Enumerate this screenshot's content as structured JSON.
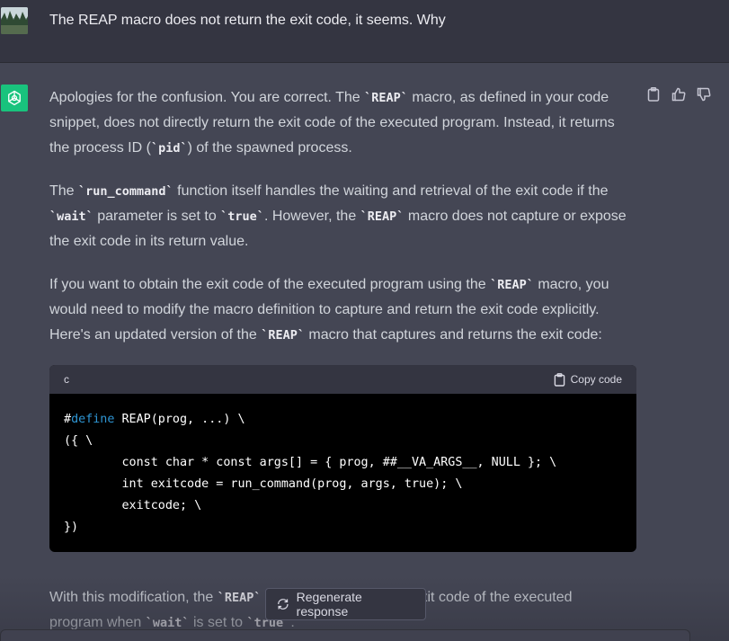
{
  "user_message": {
    "text": "The REAP macro does not return the exit code, it seems. Why"
  },
  "assistant_message": {
    "p1": {
      "a": "Apologies for the confusion. You are correct. The ",
      "code1": "`REAP`",
      "b": " macro, as defined in your code snippet, does not directly return the exit code of the executed program. Instead, it returns the process ID (",
      "code2": "`pid`",
      "c": ") of the spawned process."
    },
    "p2": {
      "a": "The ",
      "code1": "`run_command`",
      "b": " function itself handles the waiting and retrieval of the exit code if the ",
      "code2": "`wait`",
      "c": " parameter is set to ",
      "code3": "`true`",
      "d": ". However, the ",
      "code4": "`REAP`",
      "e": " macro does not capture or expose the exit code in its return value."
    },
    "p3": {
      "a": "If you want to obtain the exit code of the executed program using the ",
      "code1": "`REAP`",
      "b": " macro, you would need to modify the macro definition to capture and return the exit code explicitly. Here's an updated version of the ",
      "code2": "`REAP`",
      "c": " macro that captures and returns the exit code:"
    },
    "code_block": {
      "language": "c",
      "copy_label": "Copy code",
      "hash": "#",
      "keyword": "define",
      "line1_rest": " REAP(prog, ...) \\",
      "line2": "({ \\",
      "line3": "        const char * const args[] = { prog, ##__VA_ARGS__, NULL }; \\",
      "line4": "        int exitcode = run_command(prog, args, true); \\",
      "line5": "        exitcode; \\",
      "line6": "})"
    },
    "p4": {
      "a": "With this modification, the ",
      "code1": "`REAP`",
      "b": " macro now returns the exit code of the executed",
      "c": "program when ",
      "code2": "`wait`",
      "d": " is set to ",
      "code3": "`true`",
      "e": "."
    }
  },
  "regenerate_button": {
    "label": "Regenerate response"
  },
  "colors": {
    "user_bg": "#343541",
    "assistant_bg": "#444654",
    "logo_green": "#19c37d",
    "keyword_blue": "#2e95d3"
  }
}
